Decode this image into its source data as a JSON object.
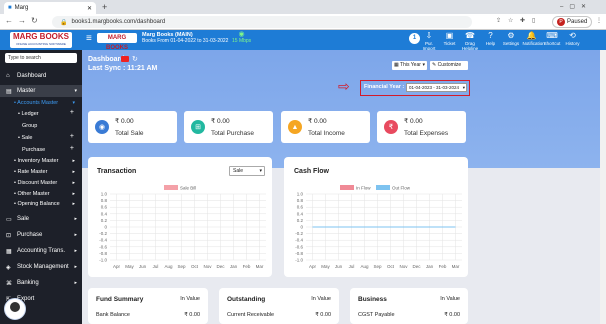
{
  "browser": {
    "tab_title": "Marg",
    "url": "books1.margbooks.com/dashboard",
    "profile_label": "Paused",
    "profile_initial": "P"
  },
  "brand": {
    "logo_text": "MARG BOOKS",
    "logo_tagline": "ONLINE ACCOUNTING SOFTWARE",
    "header_logo": "MARG BOOKS",
    "company_name": "Marg Books (MAIN)",
    "books_from": "Books From 01-04-2022 to 31-03-2022",
    "signal_label": "15 Mbps"
  },
  "header_icons": [
    {
      "label": "Pur. Import",
      "icon": "import-icon"
    },
    {
      "label": "Ticket",
      "icon": "ticket-icon"
    },
    {
      "label": "Drag Helpline",
      "icon": "helpline-icon"
    },
    {
      "label": "Help",
      "icon": "help-icon"
    },
    {
      "label": "Settings",
      "icon": "settings-icon"
    },
    {
      "label": "Notification",
      "icon": "notification-icon"
    },
    {
      "label": "Shortcut",
      "icon": "shortcut-icon"
    },
    {
      "label": "History",
      "icon": "history-icon"
    }
  ],
  "sidebar": {
    "search_placeholder": "Type to search",
    "items": [
      {
        "label": "Dashboard"
      },
      {
        "label": "Master"
      },
      {
        "label": "Sale"
      },
      {
        "label": "Purchase"
      },
      {
        "label": "Accounting Trans."
      },
      {
        "label": "Stock Management"
      },
      {
        "label": "Banking"
      },
      {
        "label": "Export"
      }
    ],
    "master_sub": [
      {
        "label": "Accounts Master"
      },
      {
        "label": "Ledger"
      },
      {
        "label": "Group"
      },
      {
        "label": "Sale"
      },
      {
        "label": "Purchase"
      },
      {
        "label": "Inventory Master"
      },
      {
        "label": "Rate Master"
      },
      {
        "label": "Discount Master"
      },
      {
        "label": "Other Master"
      },
      {
        "label": "Opening Balance"
      }
    ]
  },
  "dashboard": {
    "title": "Dashboard",
    "last_sync": "Last Sync : 11:21 AM",
    "period_select": "This Year",
    "customize_label": "Customize",
    "fy_label": "Financial Year :",
    "fy_value": "01-04-2023 - 31-03-2024"
  },
  "kpis": [
    {
      "label": "Total Sale",
      "value": "₹ 0.00",
      "color": "#3a7bd5",
      "icon": "sale-icon"
    },
    {
      "label": "Total Purchase",
      "value": "₹ 0.00",
      "color": "#22b8a0",
      "icon": "basket-icon"
    },
    {
      "label": "Total Income",
      "value": "₹ 0.00",
      "color": "#f5a623",
      "icon": "income-icon"
    },
    {
      "label": "Total Expenses",
      "value": "₹ 0.00",
      "color": "#e84a5f",
      "icon": "expense-icon"
    }
  ],
  "transaction": {
    "title": "Transaction",
    "select_value": "Sale",
    "legend": "Sale Bill"
  },
  "cashflow": {
    "title": "Cash Flow",
    "legend_in": "In Flow",
    "legend_out": "Out Flow"
  },
  "chart_data": [
    {
      "type": "bar",
      "title": "Transaction",
      "categories": [
        "Apr",
        "May",
        "Jun",
        "Jul",
        "Aug",
        "Sep",
        "Oct",
        "Nov",
        "Dec",
        "Jan",
        "Feb",
        "Mar"
      ],
      "series": [
        {
          "name": "Sale Bill",
          "values": [
            0,
            0,
            0,
            0,
            0,
            0,
            0,
            0,
            0,
            0,
            0,
            0
          ],
          "color": "#f4a1a8"
        }
      ],
      "yticks": [
        "1.0",
        "0.8",
        "0.6",
        "0.4",
        "0.2",
        "0",
        "-0.2",
        "-0.4",
        "-0.6",
        "-0.8",
        "-1.0"
      ],
      "ylim": [
        -1,
        1
      ],
      "grid": true,
      "legend": "top"
    },
    {
      "type": "line",
      "title": "Cash Flow",
      "categories": [
        "Apr",
        "May",
        "Jun",
        "Jul",
        "Aug",
        "Sep",
        "Oct",
        "Nov",
        "Dec",
        "Jan",
        "Feb",
        "Mar"
      ],
      "series": [
        {
          "name": "In Flow",
          "values": [
            0,
            0,
            0,
            0,
            0,
            0,
            0,
            0,
            0,
            0,
            0,
            0
          ],
          "color": "#f08a96"
        },
        {
          "name": "Out Flow",
          "values": [
            0,
            0,
            0,
            0,
            0,
            0,
            0,
            0,
            0,
            0,
            0,
            0
          ],
          "color": "#7ec3f0"
        }
      ],
      "yticks": [
        "1.0",
        "0.8",
        "0.6",
        "0.4",
        "0.2",
        "0",
        "-0.2",
        "-0.4",
        "-0.6",
        "-0.8",
        "-1.0"
      ],
      "ylim": [
        -1,
        1
      ],
      "grid": true,
      "legend": "top"
    }
  ],
  "bottom_cards": [
    {
      "title": "Fund Summary",
      "col": "In Value",
      "row_label": "Bank Balance",
      "row_value": "₹ 0.00"
    },
    {
      "title": "Outstanding",
      "col": "In Value",
      "row_label": "Current Receivable",
      "row_value": "₹ 0.00"
    },
    {
      "title": "Business",
      "col": "In Value",
      "row_label": "CGST Payable",
      "row_value": "₹ 0.00"
    }
  ]
}
